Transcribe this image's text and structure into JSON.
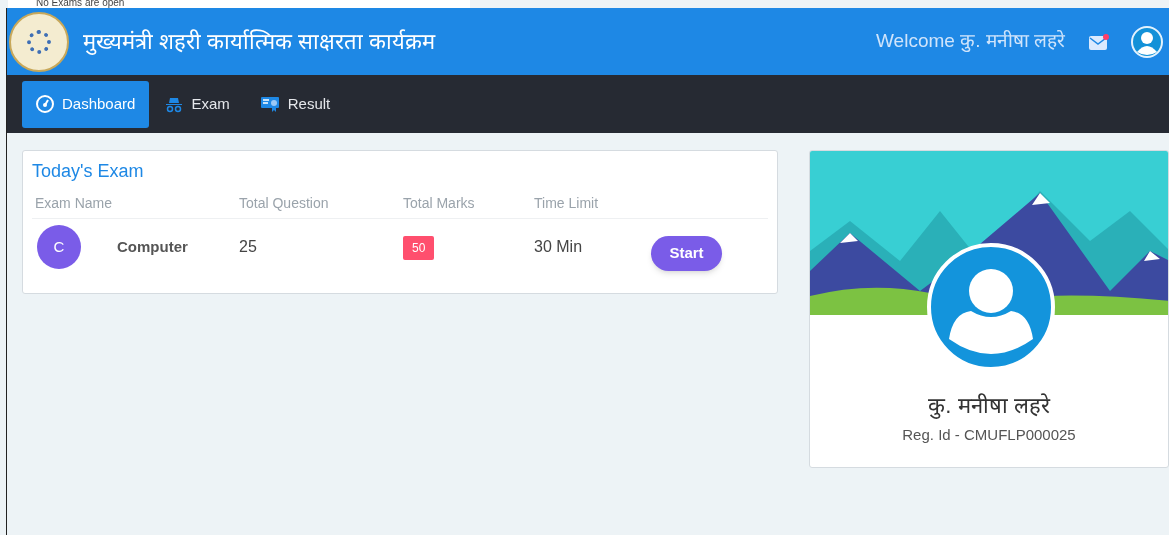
{
  "background_window": {
    "text": "No Exams are open"
  },
  "header": {
    "title": "मुख्यमंत्री शहरी कार्यात्मिक साक्षरता कार्यक्रम",
    "welcome": "Welcome कु. मनीषा लहरे",
    "mail_unread": true
  },
  "nav": [
    {
      "label": "Dashboard",
      "kind": "dashboard",
      "selected": true
    },
    {
      "label": "Exam",
      "kind": "exam",
      "selected": false
    },
    {
      "label": "Result",
      "kind": "result",
      "selected": false
    }
  ],
  "exam_card": {
    "title": "Today's Exam",
    "columns": [
      "Exam Name",
      "Total Question",
      "Total Marks",
      "Time Limit"
    ],
    "rows": [
      {
        "avatar": "C",
        "name": "Computer",
        "questions": "25",
        "marks": "50",
        "time": "30 Min",
        "button": "Start"
      }
    ]
  },
  "profile": {
    "name": "कु. मनीषा लहरे",
    "reg_id": "Reg. Id - CMUFLP000025"
  }
}
